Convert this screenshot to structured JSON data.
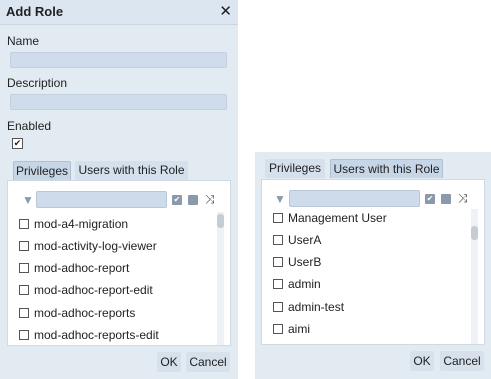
{
  "left_dialog": {
    "title": "Add Role",
    "close_glyph": "✕",
    "name_label": "Name",
    "name_value": "",
    "description_label": "Description",
    "description_value": "",
    "enabled_label": "Enabled",
    "enabled_checked": true,
    "enabled_check_glyph": "✔",
    "tabs": [
      "Privileges",
      "Users with this Role"
    ],
    "active_tab": "Privileges",
    "filter_icon_glyph": "▼",
    "filter_value": "",
    "toolbar": {
      "check_all_glyph": "✔",
      "shuffle_glyph": "⤨"
    },
    "items": [
      "mod-a4-migration",
      "mod-activity-log-viewer",
      "mod-adhoc-report",
      "mod-adhoc-report-edit",
      "mod-adhoc-reports",
      "mod-adhoc-reports-edit"
    ],
    "ok_label": "OK",
    "cancel_label": "Cancel"
  },
  "right_dialog": {
    "tabs": [
      "Privileges",
      "Users with this Role"
    ],
    "active_tab": "Users with this Role",
    "filter_icon_glyph": "▼",
    "filter_value": "",
    "toolbar": {
      "check_all_glyph": "✔",
      "shuffle_glyph": "⤨"
    },
    "items": [
      "Management User",
      "UserA",
      "UserB",
      "admin",
      "admin-test",
      "aimi"
    ],
    "ok_label": "OK",
    "cancel_label": "Cancel"
  },
  "colors": {
    "dialog_bg": "#e2eaf2",
    "field_bg": "#cfdceb",
    "active_tab": "#c6d6e6"
  }
}
